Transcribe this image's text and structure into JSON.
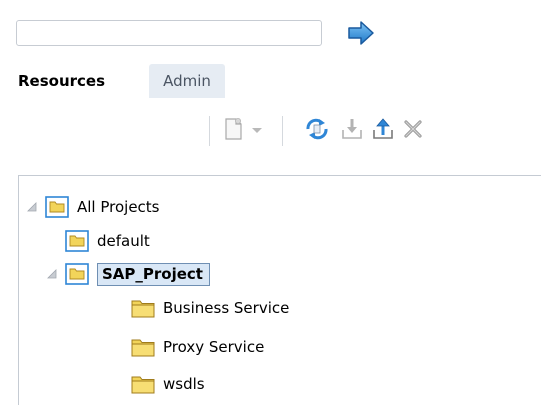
{
  "search": {
    "value": "",
    "placeholder": ""
  },
  "tabs": [
    {
      "label": "Resources",
      "active": true
    },
    {
      "label": "Admin",
      "active": false
    }
  ],
  "toolbar": {
    "buttons": [
      "new-document-icon",
      "dropdown-arrow-icon",
      "refresh-icon",
      "import-icon",
      "export-icon",
      "delete-icon"
    ]
  },
  "tree": {
    "root": {
      "label": "All Projects",
      "expanded": true
    },
    "default": {
      "label": "default"
    },
    "sap": {
      "label": "SAP_Project",
      "expanded": true,
      "selected": true
    },
    "children": [
      {
        "label": "Business Service"
      },
      {
        "label": "Proxy Service"
      },
      {
        "label": "wsdls"
      }
    ]
  },
  "colors": {
    "accent_blue": "#2f86d6",
    "selection_bg": "#d9e7f6",
    "folder_yellow": "#f2d45a",
    "tab_inactive_bg": "#e6ecf3"
  }
}
